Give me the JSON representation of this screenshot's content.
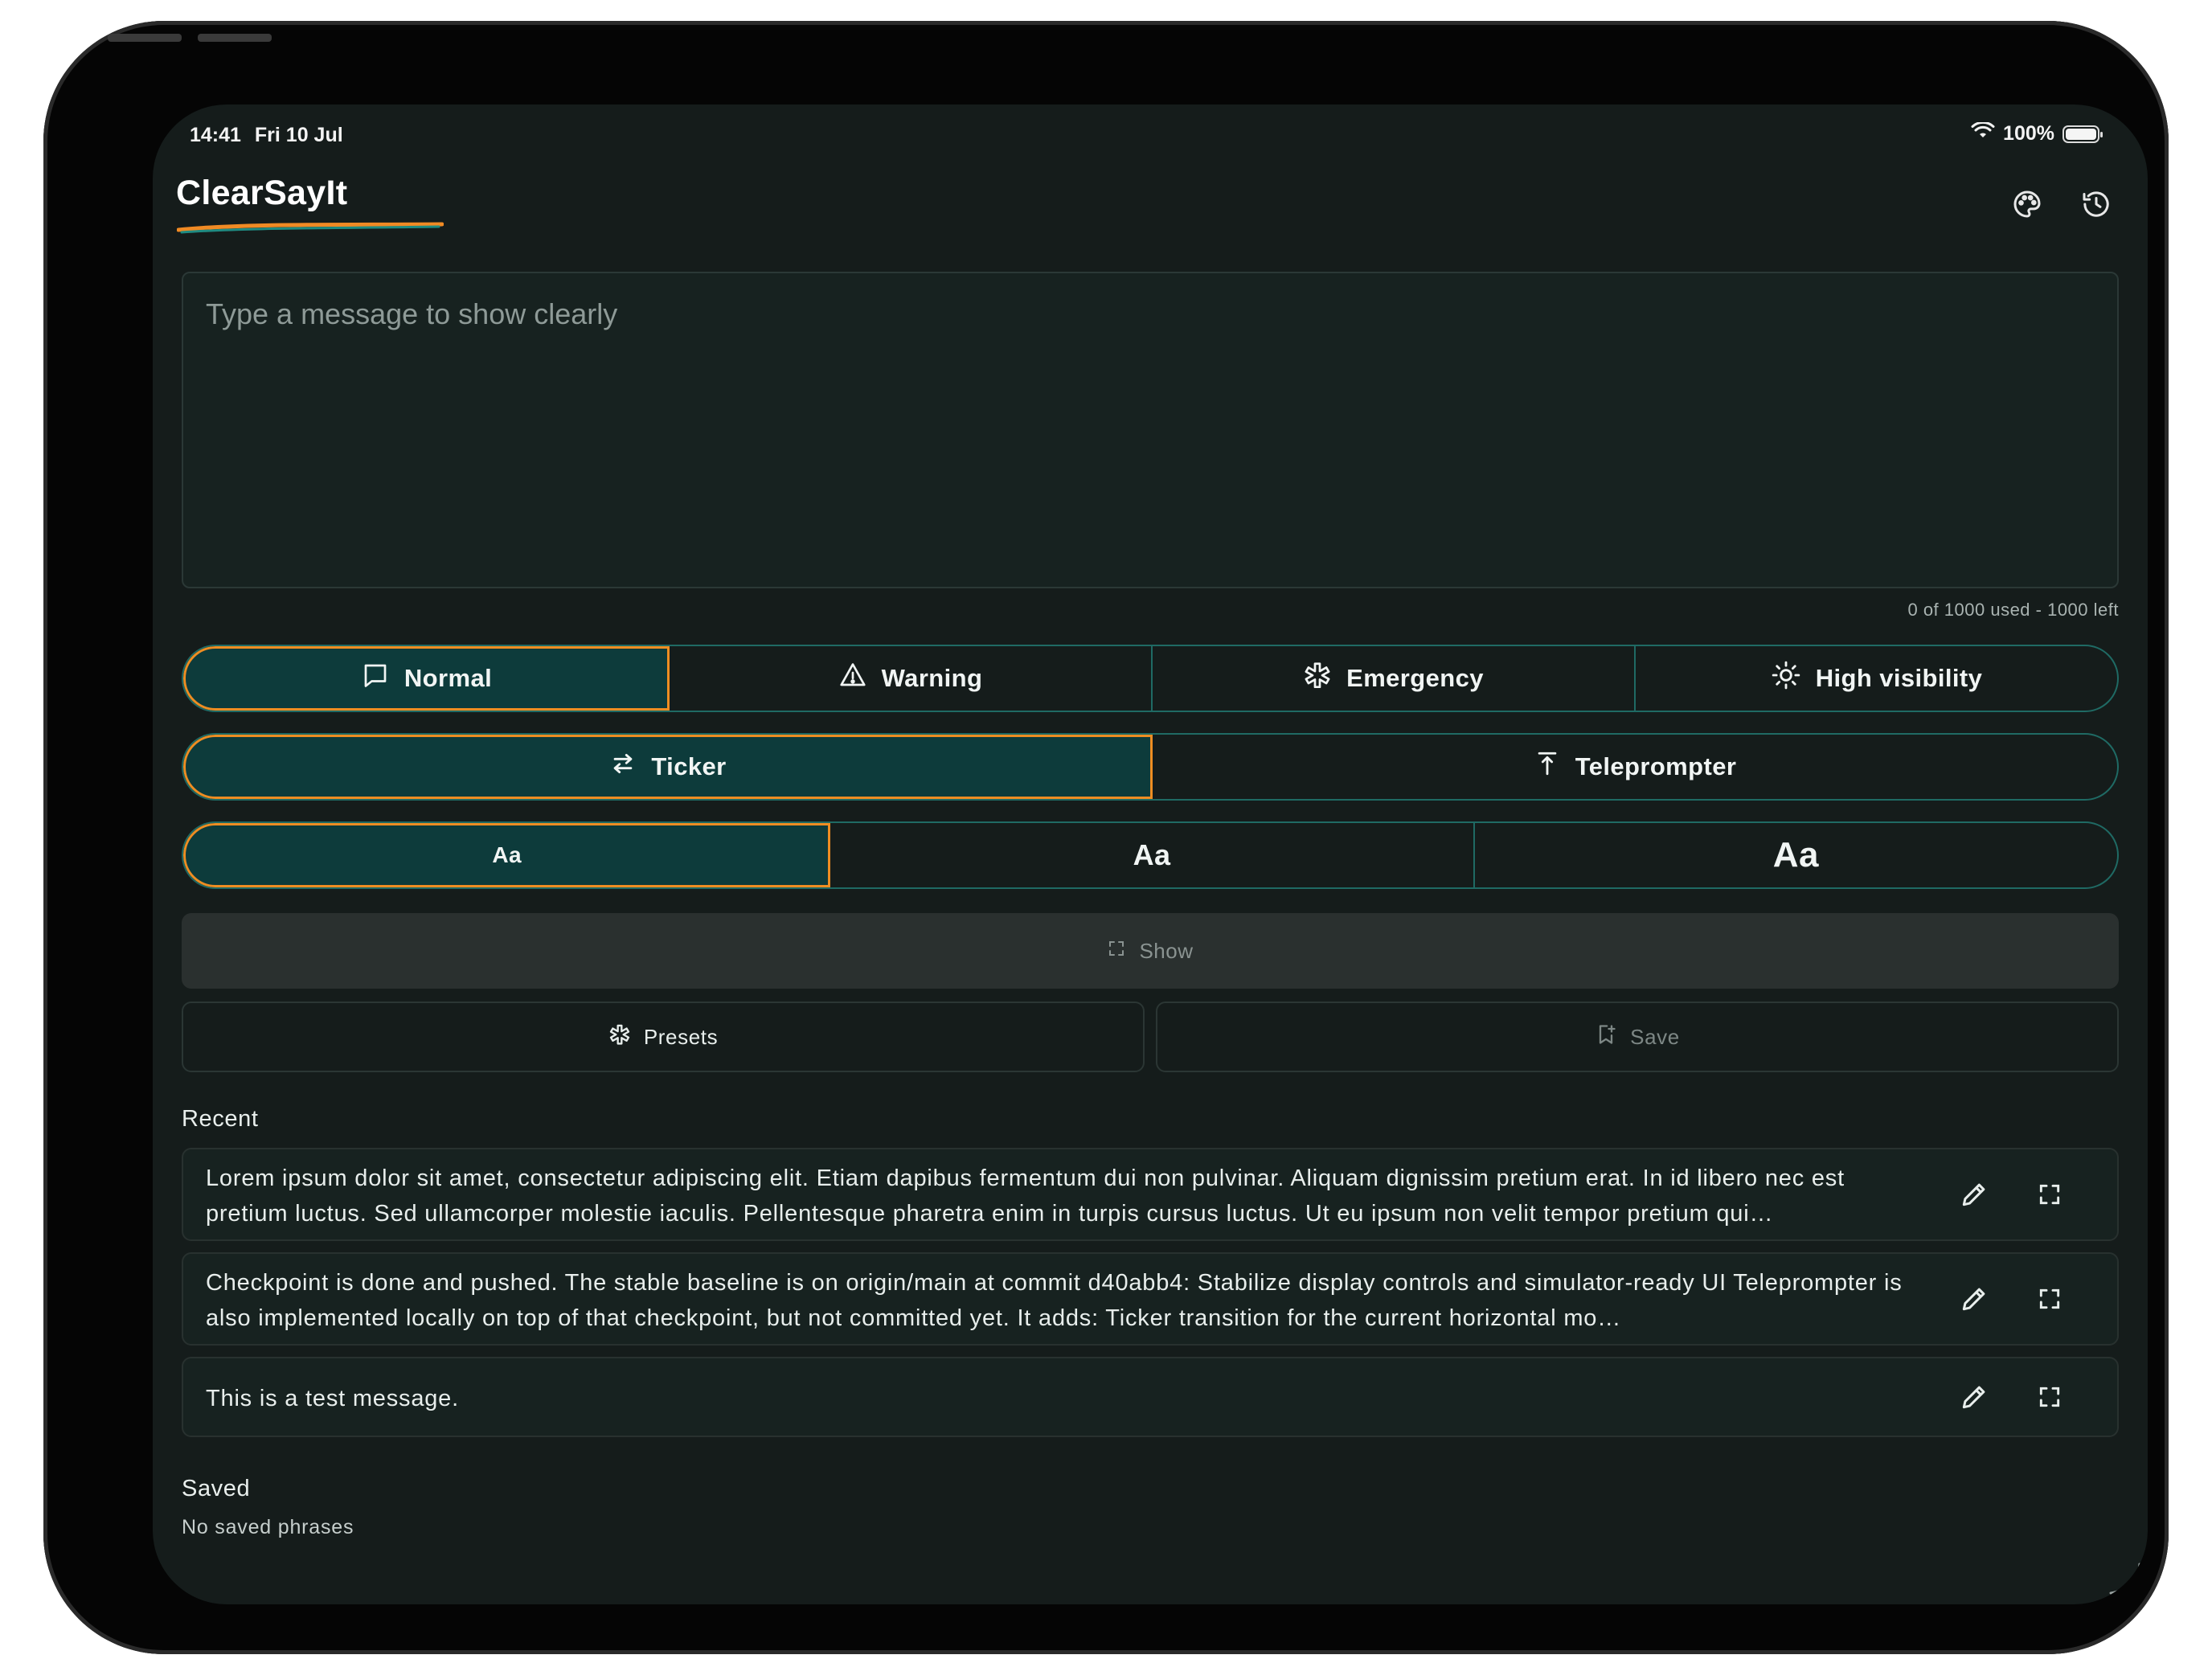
{
  "status_bar": {
    "time": "14:41",
    "date": "Fri 10 Jul",
    "battery": "100%",
    "battery_level": 1.0
  },
  "app": {
    "title": "ClearSayIt"
  },
  "header": {
    "palette_icon": "palette-icon",
    "history_icon": "history-icon"
  },
  "composer": {
    "placeholder": "Type a message to show clearly",
    "value": "",
    "counter": "0 of 1000 used - 1000 left"
  },
  "style_modes": [
    {
      "label": "Normal",
      "icon": "message-square-icon",
      "selected": true
    },
    {
      "label": "Warning",
      "icon": "warning-triangle-icon",
      "selected": false
    },
    {
      "label": "Emergency",
      "icon": "asterisk-icon",
      "selected": false
    },
    {
      "label": "High visibility",
      "icon": "sun-icon",
      "selected": false
    }
  ],
  "display_modes": [
    {
      "label": "Ticker",
      "icon": "arrows-left-right-icon",
      "selected": true
    },
    {
      "label": "Teleprompter",
      "icon": "arrow-up-bar-icon",
      "selected": false
    }
  ],
  "text_sizes": [
    {
      "label": "Aa",
      "selected": true
    },
    {
      "label": "Aa",
      "selected": false
    },
    {
      "label": "Aa",
      "selected": false
    }
  ],
  "actions": {
    "show": "Show",
    "presets": "Presets",
    "save": "Save"
  },
  "recent": {
    "label": "Recent",
    "items": [
      {
        "text": "Lorem ipsum dolor sit amet, consectetur adipiscing elit. Etiam dapibus fermentum dui non pulvinar. Aliquam dignissim pretium erat. In id libero nec est pretium luctus. Sed ullamcorper molestie iaculis. Pellentesque pharetra enim in turpis cursus luctus. Ut eu ipsum non velit tempor pretium qui…"
      },
      {
        "text": "Checkpoint is done and pushed. The stable baseline is on origin/main at commit d40abb4: Stabilize display controls and simulator-ready UI Teleprompter is also implemented locally on top of that checkpoint, but not committed yet. It adds: Ticker transition for the current horizontal mo…"
      },
      {
        "text": "This is a test message."
      }
    ]
  },
  "saved": {
    "label": "Saved",
    "empty": "No saved phrases"
  },
  "colors": {
    "background": "#151c1b",
    "accent_teal": "#1f6a64",
    "selected_fill": "#0d3b3b",
    "selected_outline": "#ee8d22",
    "brand_orange": "#f08a24"
  }
}
